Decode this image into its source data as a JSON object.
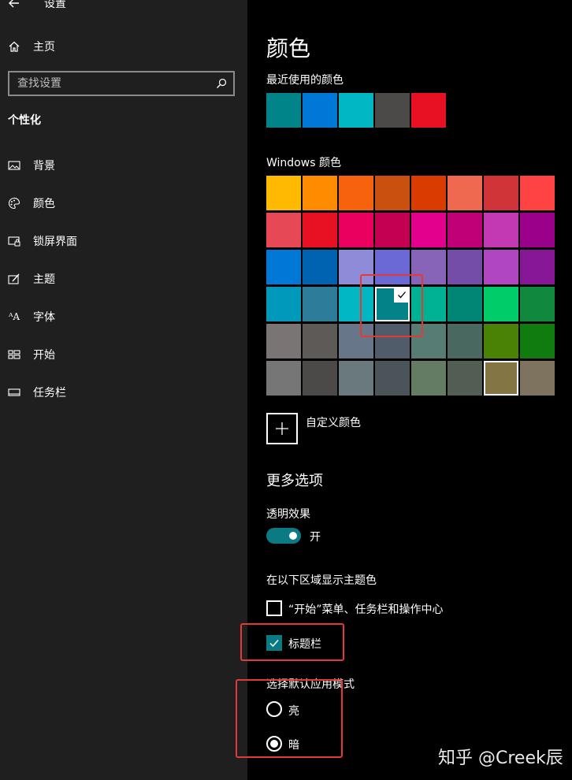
{
  "header": {
    "title": "设置"
  },
  "sidebar": {
    "home_label": "主页",
    "search_placeholder": "查找设置",
    "section_title": "个性化",
    "items": [
      {
        "label": "背景",
        "icon": "picture-icon"
      },
      {
        "label": "颜色",
        "icon": "palette-icon"
      },
      {
        "label": "锁屏界面",
        "icon": "lock-screen-icon"
      },
      {
        "label": "主题",
        "icon": "theme-icon"
      },
      {
        "label": "字体",
        "icon": "font-icon"
      },
      {
        "label": "开始",
        "icon": "start-icon"
      },
      {
        "label": "任务栏",
        "icon": "taskbar-icon"
      }
    ]
  },
  "main": {
    "title": "颜色",
    "recent_label": "最近使用的颜色",
    "recent_colors": [
      "#008489",
      "#0078d7",
      "#00b7c3",
      "#4c4a48",
      "#e81123"
    ],
    "windows_label": "Windows 颜色",
    "windows_colors": [
      [
        "#ffb900",
        "#ff8c00",
        "#f7630c",
        "#ca5010",
        "#da3b01",
        "#ef6950",
        "#d13438",
        "#ff4343"
      ],
      [
        "#e74856",
        "#e81123",
        "#ea005e",
        "#c30052",
        "#e3008c",
        "#bf0077",
        "#c239b3",
        "#9a0089"
      ],
      [
        "#0078d7",
        "#0063b1",
        "#8e8cd8",
        "#6b69d6",
        "#8764b8",
        "#744da9",
        "#b146c2",
        "#881798"
      ],
      [
        "#0099bc",
        "#2d7d9a",
        "#00b7c3",
        "#038387",
        "#00b294",
        "#018574",
        "#00cc6a",
        "#10893e"
      ],
      [
        "#7a7574",
        "#5d5a58",
        "#68768a",
        "#515c6b",
        "#567c73",
        "#486860",
        "#498205",
        "#107c10"
      ],
      [
        "#767676",
        "#4c4a48",
        "#69797e",
        "#4a5459",
        "#647c64",
        "#525e54",
        "#847545",
        "#7e735f"
      ]
    ],
    "selected_color": "#038387",
    "custom_color_label": "自定义颜色",
    "more_options_title": "更多选项",
    "transparency_label": "透明效果",
    "transparency_state": "开",
    "accent_surfaces_label": "在以下区域显示主题色",
    "accent_start_label": "“开始”菜单、任务栏和操作中心",
    "accent_titlebar_label": "标题栏",
    "app_mode_label": "选择默认应用模式",
    "mode_light_label": "亮",
    "mode_dark_label": "暗"
  },
  "watermark": "知乎 @Creek辰",
  "colors": {
    "accent": "#0a7a83",
    "annotation": "#e53935",
    "sidebar_bg": "#1f1f1f"
  }
}
